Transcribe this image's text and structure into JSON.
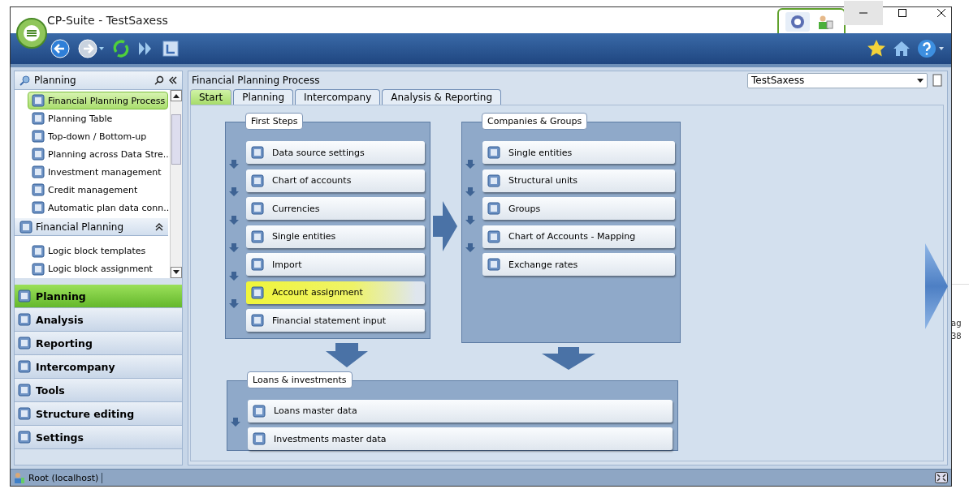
{
  "window": {
    "title": "CP-Suite - TestSaxess"
  },
  "sidebar": {
    "header": "Planning",
    "items": [
      {
        "label": "Financial Planning Process",
        "selected": true
      },
      {
        "label": "Planning Table",
        "selected": false
      },
      {
        "label": "Top-down / Bottom-up",
        "selected": false
      },
      {
        "label": "Planning across Data Stre...",
        "selected": false
      },
      {
        "label": "Investment management",
        "selected": false
      },
      {
        "label": "Credit management",
        "selected": false
      },
      {
        "label": "Automatic plan data conn...",
        "selected": false
      }
    ],
    "subsection": {
      "label": "Financial Planning",
      "expanded": true,
      "items": [
        {
          "label": "Logic block templates",
          "selected": false
        },
        {
          "label": "Logic block assignment",
          "selected": false
        }
      ]
    },
    "nav": [
      {
        "label": "Planning",
        "selected": true
      },
      {
        "label": "Analysis",
        "selected": false
      },
      {
        "label": "Reporting",
        "selected": false
      },
      {
        "label": "Intercompany",
        "selected": false
      },
      {
        "label": "Tools",
        "selected": false
      },
      {
        "label": "Structure editing",
        "selected": false
      },
      {
        "label": "Settings",
        "selected": false
      }
    ]
  },
  "main": {
    "title": "Financial Planning Process",
    "dropdown": "TestSaxess",
    "tabs": [
      {
        "label": "Start",
        "selected": true
      },
      {
        "label": "Planning",
        "selected": false
      },
      {
        "label": "Intercompany",
        "selected": false
      },
      {
        "label": "Analysis & Reporting",
        "selected": false
      }
    ],
    "groups": [
      {
        "title": "First Steps",
        "steps": [
          {
            "label": "Data source settings",
            "highlighted": false
          },
          {
            "label": "Chart of accounts",
            "highlighted": false
          },
          {
            "label": "Currencies",
            "highlighted": false
          },
          {
            "label": "Single entities",
            "highlighted": false
          },
          {
            "label": "Import",
            "highlighted": false
          },
          {
            "label": "Account assignment",
            "highlighted": true
          },
          {
            "label": "Financial statement input",
            "highlighted": false
          }
        ]
      },
      {
        "title": "Companies & Groups",
        "steps": [
          {
            "label": "Single entities",
            "highlighted": false
          },
          {
            "label": "Structural units",
            "highlighted": false
          },
          {
            "label": "Groups",
            "highlighted": false
          },
          {
            "label": "Chart of Accounts - Mapping",
            "highlighted": false
          },
          {
            "label": "Exchange rates",
            "highlighted": false
          }
        ]
      },
      {
        "title": "Loans & investments",
        "steps": [
          {
            "label": "Loans master data",
            "highlighted": false
          },
          {
            "label": "Investments master data",
            "highlighted": false
          }
        ]
      }
    ]
  },
  "status_bar": {
    "text": "Root (localhost)"
  },
  "background_window": {
    "texts": [
      "ag",
      "38"
    ]
  }
}
